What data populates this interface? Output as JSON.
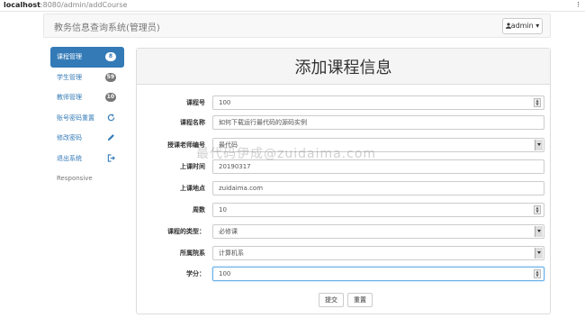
{
  "browser": {
    "host": "localhost",
    "path": ":8080/admin/addCourse",
    "menu": "⁝"
  },
  "navbar": {
    "brand": "教务信息查询系统(管理员)",
    "user_label": "admin ▾"
  },
  "sidebar": {
    "items": [
      {
        "label": "课程管理",
        "badge": "8",
        "active": true
      },
      {
        "label": "学生管理",
        "badge": "59"
      },
      {
        "label": "教师管理",
        "badge": "10"
      },
      {
        "label": "账号密码重置",
        "icon": "refresh-icon"
      },
      {
        "label": "修改密码",
        "icon": "pencil-icon"
      },
      {
        "label": "退出系统",
        "icon": "logout-icon"
      },
      {
        "label": "Responsive"
      }
    ]
  },
  "form": {
    "title": "添加课程信息",
    "fields": [
      {
        "label": "课程号",
        "value": "100",
        "type": "number"
      },
      {
        "label": "课程名称",
        "value": "如何下载运行最代码的源码实例",
        "type": "text"
      },
      {
        "label": "授课老师编号",
        "value": "最代码",
        "type": "select"
      },
      {
        "label": "上课时间",
        "value": "20190317",
        "type": "text"
      },
      {
        "label": "上课地点",
        "value": "zuidaima.com",
        "type": "text"
      },
      {
        "label": "周数",
        "value": "10",
        "type": "number"
      },
      {
        "label": "课程的类型：",
        "value": "必修课",
        "type": "select"
      },
      {
        "label": "所属院系",
        "value": "计算机系",
        "type": "select"
      },
      {
        "label": "学分：",
        "value": "100",
        "type": "number"
      }
    ],
    "submit_label": "提交",
    "reset_label": "重置"
  },
  "watermark": "最代码伊成@zuidaima.com"
}
